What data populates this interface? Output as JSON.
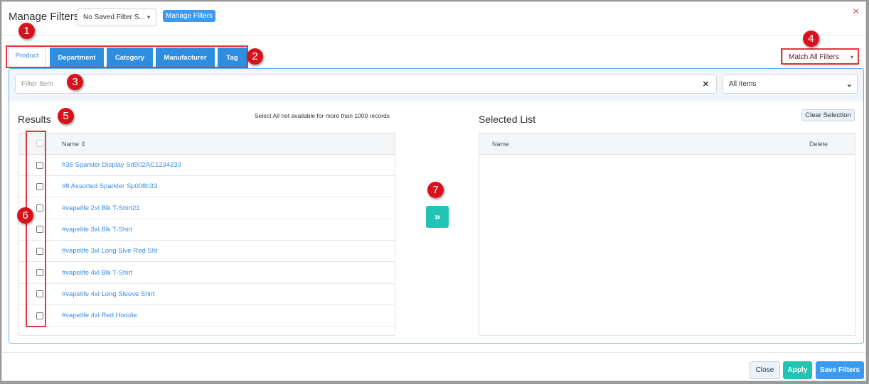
{
  "header": {
    "title": "Manage Filters",
    "saved_filter_value": "No Saved Filter S...",
    "manage_filters_button": "Manage Filters",
    "close_icon": "×"
  },
  "tabs": [
    {
      "label": "Product",
      "active": true
    },
    {
      "label": "Department"
    },
    {
      "label": "Category"
    },
    {
      "label": "Manufacturer"
    },
    {
      "label": "Tag"
    }
  ],
  "match_select": {
    "value": "Match All Filters"
  },
  "filter": {
    "placeholder": "Filter Item",
    "clear_icon": "✕",
    "scope_value": "All Items"
  },
  "results": {
    "title": "Results",
    "note": "Select All not available for more than 1000 records",
    "column_name": "Name",
    "sort_icon": "⇕",
    "rows": [
      "#36 Sparkler Display Sd002AC1234233",
      "#8 Assorted Sparkler Sp008h33",
      "#vapelife 2xl Blk T-Shirt21",
      "#vapelife 3xl Blk T-Shirt",
      "#vapelife 3xl Long Slve Red Sht",
      "#vapelife 4xl Blk T-Shirt",
      "#vapelife 4xl Long Sleeve Shirt",
      "#vapelife 4xl Red Hoodie"
    ]
  },
  "move_button": "»",
  "selected": {
    "title": "Selected List",
    "clear_button": "Clear Selection",
    "column_name": "Name",
    "column_delete": "Delete"
  },
  "footer": {
    "close": "Close",
    "apply": "Apply",
    "save": "Save Filters"
  },
  "annotations": [
    "1",
    "2",
    "3",
    "4",
    "5",
    "6",
    "7"
  ],
  "colors": {
    "primary": "#2f8ddf",
    "teal": "#20c4b4",
    "annotation": "#d8121c"
  }
}
